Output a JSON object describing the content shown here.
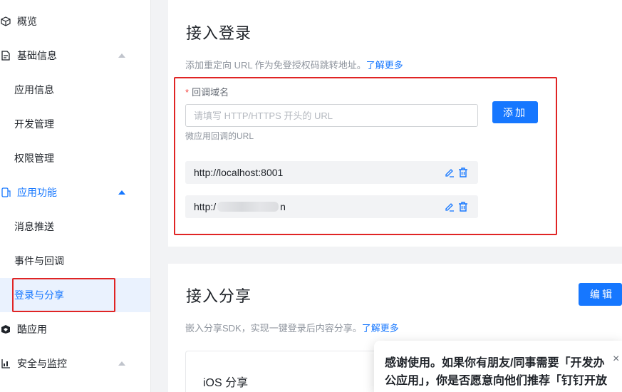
{
  "sidebar": {
    "items": [
      {
        "label": "概览",
        "icon": "cube-icon"
      },
      {
        "label": "基础信息",
        "icon": "document-icon"
      },
      {
        "label": "应用信息"
      },
      {
        "label": "开发管理"
      },
      {
        "label": "权限管理"
      },
      {
        "label": "应用功能",
        "icon": "app-function-icon"
      },
      {
        "label": "消息推送"
      },
      {
        "label": "事件与回调"
      },
      {
        "label": "登录与分享"
      },
      {
        "label": "酷应用",
        "icon": "cool-app-icon"
      },
      {
        "label": "安全与监控",
        "icon": "chart-icon"
      }
    ]
  },
  "login": {
    "title": "接入登录",
    "desc": "添加重定向 URL 作为免登授权码跳转地址。",
    "learn_more": "了解更多",
    "field_required": "*",
    "field_label": "回调域名",
    "input_placeholder": "请填写 HTTP/HTTPS 开头的 URL",
    "input_value": "",
    "hint": "微应用回调的URL",
    "add_label": "添加",
    "urls": [
      {
        "prefix": "http://localhost:8001",
        "suffix": ""
      },
      {
        "prefix": "http:/",
        "suffix": "n"
      }
    ]
  },
  "share": {
    "title": "接入分享",
    "edit_label": "编辑",
    "desc": "嵌入分享SDK，实现一键登录后内容分享。",
    "learn_more": "了解更多",
    "ios_title": "iOS 分享"
  },
  "popup": {
    "text": "感谢使用。如果你有朋友/同事需要「开发办公应用」，你是否愿意向他们推荐「钉钉开放平台」",
    "close": "×"
  },
  "colors": {
    "accent": "#1677ff",
    "highlight_box": "#e02424",
    "required": "#f54a45"
  }
}
